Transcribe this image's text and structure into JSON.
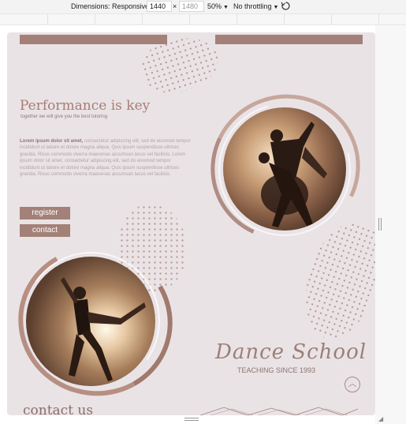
{
  "devtools": {
    "dimensions_label": "Dimensions: Responsive",
    "width_value": "1440",
    "times_sign": "×",
    "height_placeholder": "1480",
    "zoom_label": "50%",
    "throttle_label": "No throttling",
    "rotate_icon": "rotate-icon"
  },
  "page": {
    "hero": {
      "title": "Performance is key",
      "subtitle": "together we will give you the best tutoring",
      "lead_bold": "Lorem ipsum dolor sit amet,",
      "body": "consectetur adipiscing elit, sed do eiusmod tempor incididunt ut labore et dolore magna aliqua. Quis ipsum suspendisse ultrices gravida. Risus commodo viverra maecenas accumsan lacus vel facilisis. Lorem ipsum dolor sit amet, consectetur adipiscing elit, sed do eiusmod tempor incididunt ut labore et dolore magna aliqua. Quis ipsum suspendisse ultrices gravida. Risus commodo viverra maecenas accumsan lacus vel facilisis."
    },
    "buttons": {
      "register": "register",
      "contact": "contact"
    },
    "brand": {
      "name": "Dance School",
      "tagline": "TEACHING SINCE 1993"
    },
    "scroll_top_icon": "chevron-up-icon",
    "section_heading": "contact us",
    "colors": {
      "accent": "#a38178",
      "background": "#eae3e6",
      "title": "#a67d73"
    }
  }
}
